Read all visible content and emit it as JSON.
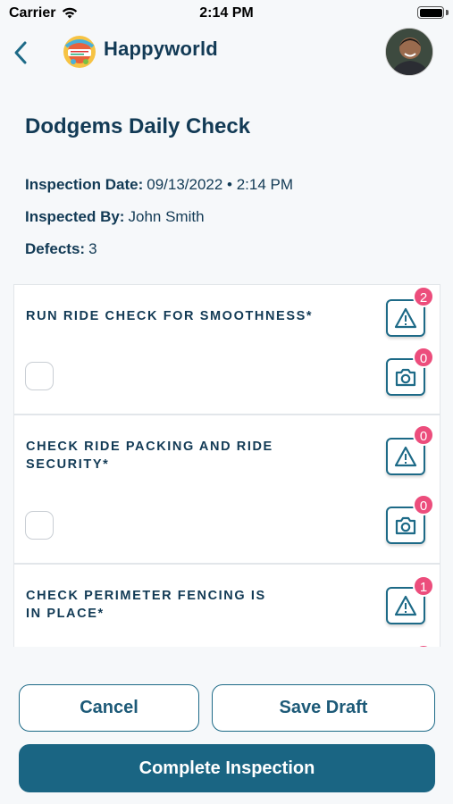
{
  "status_bar": {
    "carrier": "Carrier",
    "time": "2:14 PM"
  },
  "nav": {
    "brand": "Happyworld",
    "back_icon": "chevron-left-icon",
    "avatar": "user-avatar"
  },
  "inspection": {
    "title": "Dodgems Daily Check",
    "date_label": "Inspection Date:",
    "date_value": "09/13/2022 • 2:14 PM",
    "inspector_label": "Inspected By:",
    "inspector_value": "John Smith",
    "defects_label": "Defects:",
    "defects_value": "3"
  },
  "checklist": [
    {
      "title": "RUN RIDE CHECK FOR SMOOTHNESS*",
      "defect_count": "2",
      "photo_count": "0",
      "checked": false
    },
    {
      "title": "CHECK RIDE PACKING AND RIDE SECURITY*",
      "defect_count": "0",
      "photo_count": "0",
      "checked": false
    },
    {
      "title": "CHECK PERIMETER FENCING IS IN PLACE*",
      "defect_count": "1",
      "photo_count": "",
      "checked": false
    }
  ],
  "actions": {
    "cancel": "Cancel",
    "save_draft": "Save Draft",
    "complete": "Complete Inspection"
  },
  "colors": {
    "primary": "#1a6583",
    "text": "#123a55",
    "badge": "#ec4d7c",
    "background": "#f6f8fa"
  }
}
